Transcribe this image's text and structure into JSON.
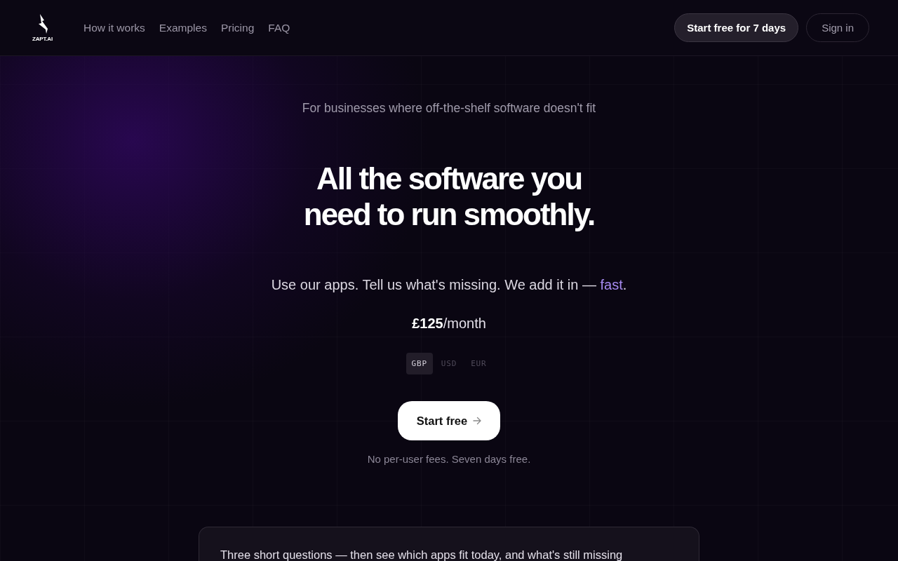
{
  "header": {
    "logo": {
      "text": "ZAPT.AI"
    },
    "nav": [
      "How it works",
      "Examples",
      "Pricing",
      "FAQ"
    ],
    "buttons": [
      {
        "label": "Start free for 7 days",
        "kind": "primary"
      },
      {
        "label": "Sign in",
        "kind": "outline"
      }
    ]
  },
  "hero": {
    "eyebrow": "For businesses where off-the-shelf software doesn't fit",
    "headline": [
      "All the software you",
      "need to run smoothly."
    ],
    "tagline": {
      "text": "Use our apps. Tell us what's missing. We add it in — ",
      "highlight": "fast",
      "end": "."
    },
    "price": "**£125**/month",
    "currencies": [
      {
        "label": "GBP",
        "selected": true
      },
      {
        "label": "USD",
        "selected": false
      },
      {
        "label": "EUR",
        "selected": false
      }
    ],
    "cta": {
      "label": "Start free"
    },
    "note": "No per-user fees. Seven days free."
  },
  "card": {
    "text": "Three short questions — then see which apps fit today, and what's still missing"
  }
}
